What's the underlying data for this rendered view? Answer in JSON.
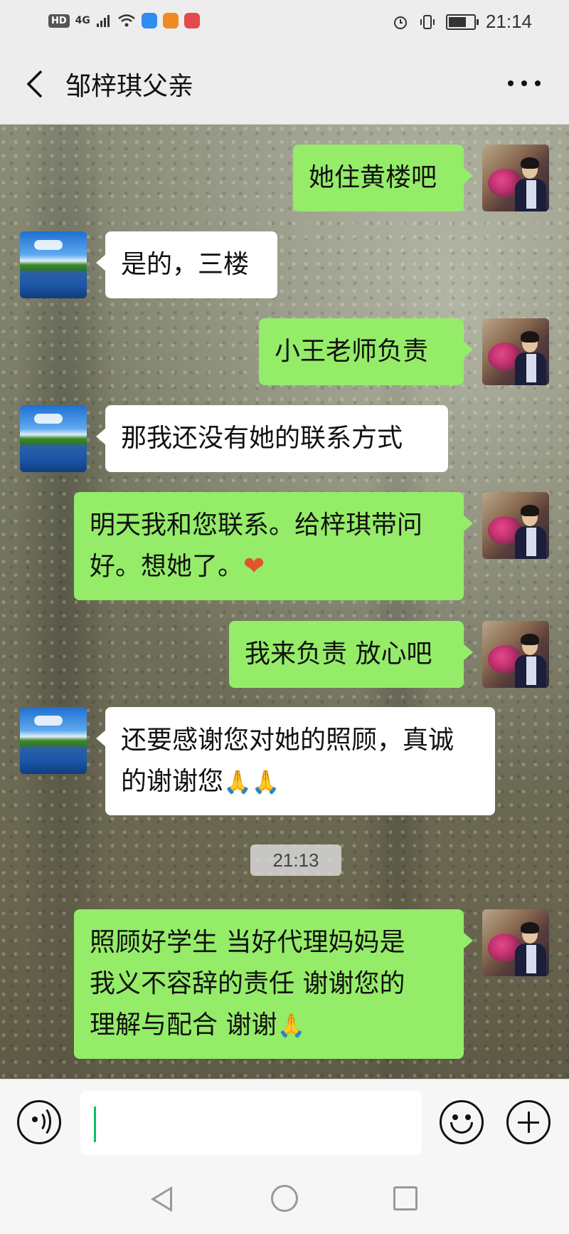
{
  "status_bar": {
    "network": "HD",
    "signal": "4G",
    "time": "21:14",
    "battery_level": 0.7,
    "icons": [
      "hd-icon",
      "signal-icon",
      "wifi-icon",
      "app-icon-blue",
      "app-icon-orange",
      "app-icon-red",
      "alarm-icon",
      "vibrate-icon",
      "battery-icon"
    ]
  },
  "header": {
    "title": "邹梓琪父亲",
    "back_icon": "chevron-left-icon",
    "more_icon": "more-dots-icon"
  },
  "messages": [
    {
      "side": "right",
      "text": "她住黄楼吧"
    },
    {
      "side": "left",
      "text": "是的，三楼"
    },
    {
      "side": "right",
      "text": "小王老师负责"
    },
    {
      "side": "left",
      "text": "那我还没有她的联系方式"
    },
    {
      "side": "right",
      "line1": "明天我和您联系。给梓琪带问",
      "line2": "好。想她了。",
      "emoji": "❤"
    },
    {
      "side": "right",
      "text": "我来负责 放心吧"
    },
    {
      "side": "left",
      "line1": "还要感谢您对她的照顾，真诚",
      "line2": "的谢谢您",
      "emoji": "🙏🙏"
    },
    {
      "side": "right",
      "line1": "照顾好学生 当好代理妈妈是",
      "line2": "我义不容辞的责任 谢谢您的",
      "line3": "理解与配合 谢谢",
      "emoji": "🙏"
    }
  ],
  "timestamp": "21:13",
  "input_bar": {
    "voice_icon": "voice-icon",
    "text_value": "",
    "emoji_icon": "emoji-icon",
    "plus_icon": "plus-icon"
  },
  "nav_bar": {
    "icons": [
      "nav-back-icon",
      "nav-home-icon",
      "nav-recent-icon"
    ]
  },
  "colors": {
    "my_bubble": "#95ec69",
    "their_bubble": "#ffffff",
    "header_bg": "#ededed",
    "caret": "#07c160"
  }
}
